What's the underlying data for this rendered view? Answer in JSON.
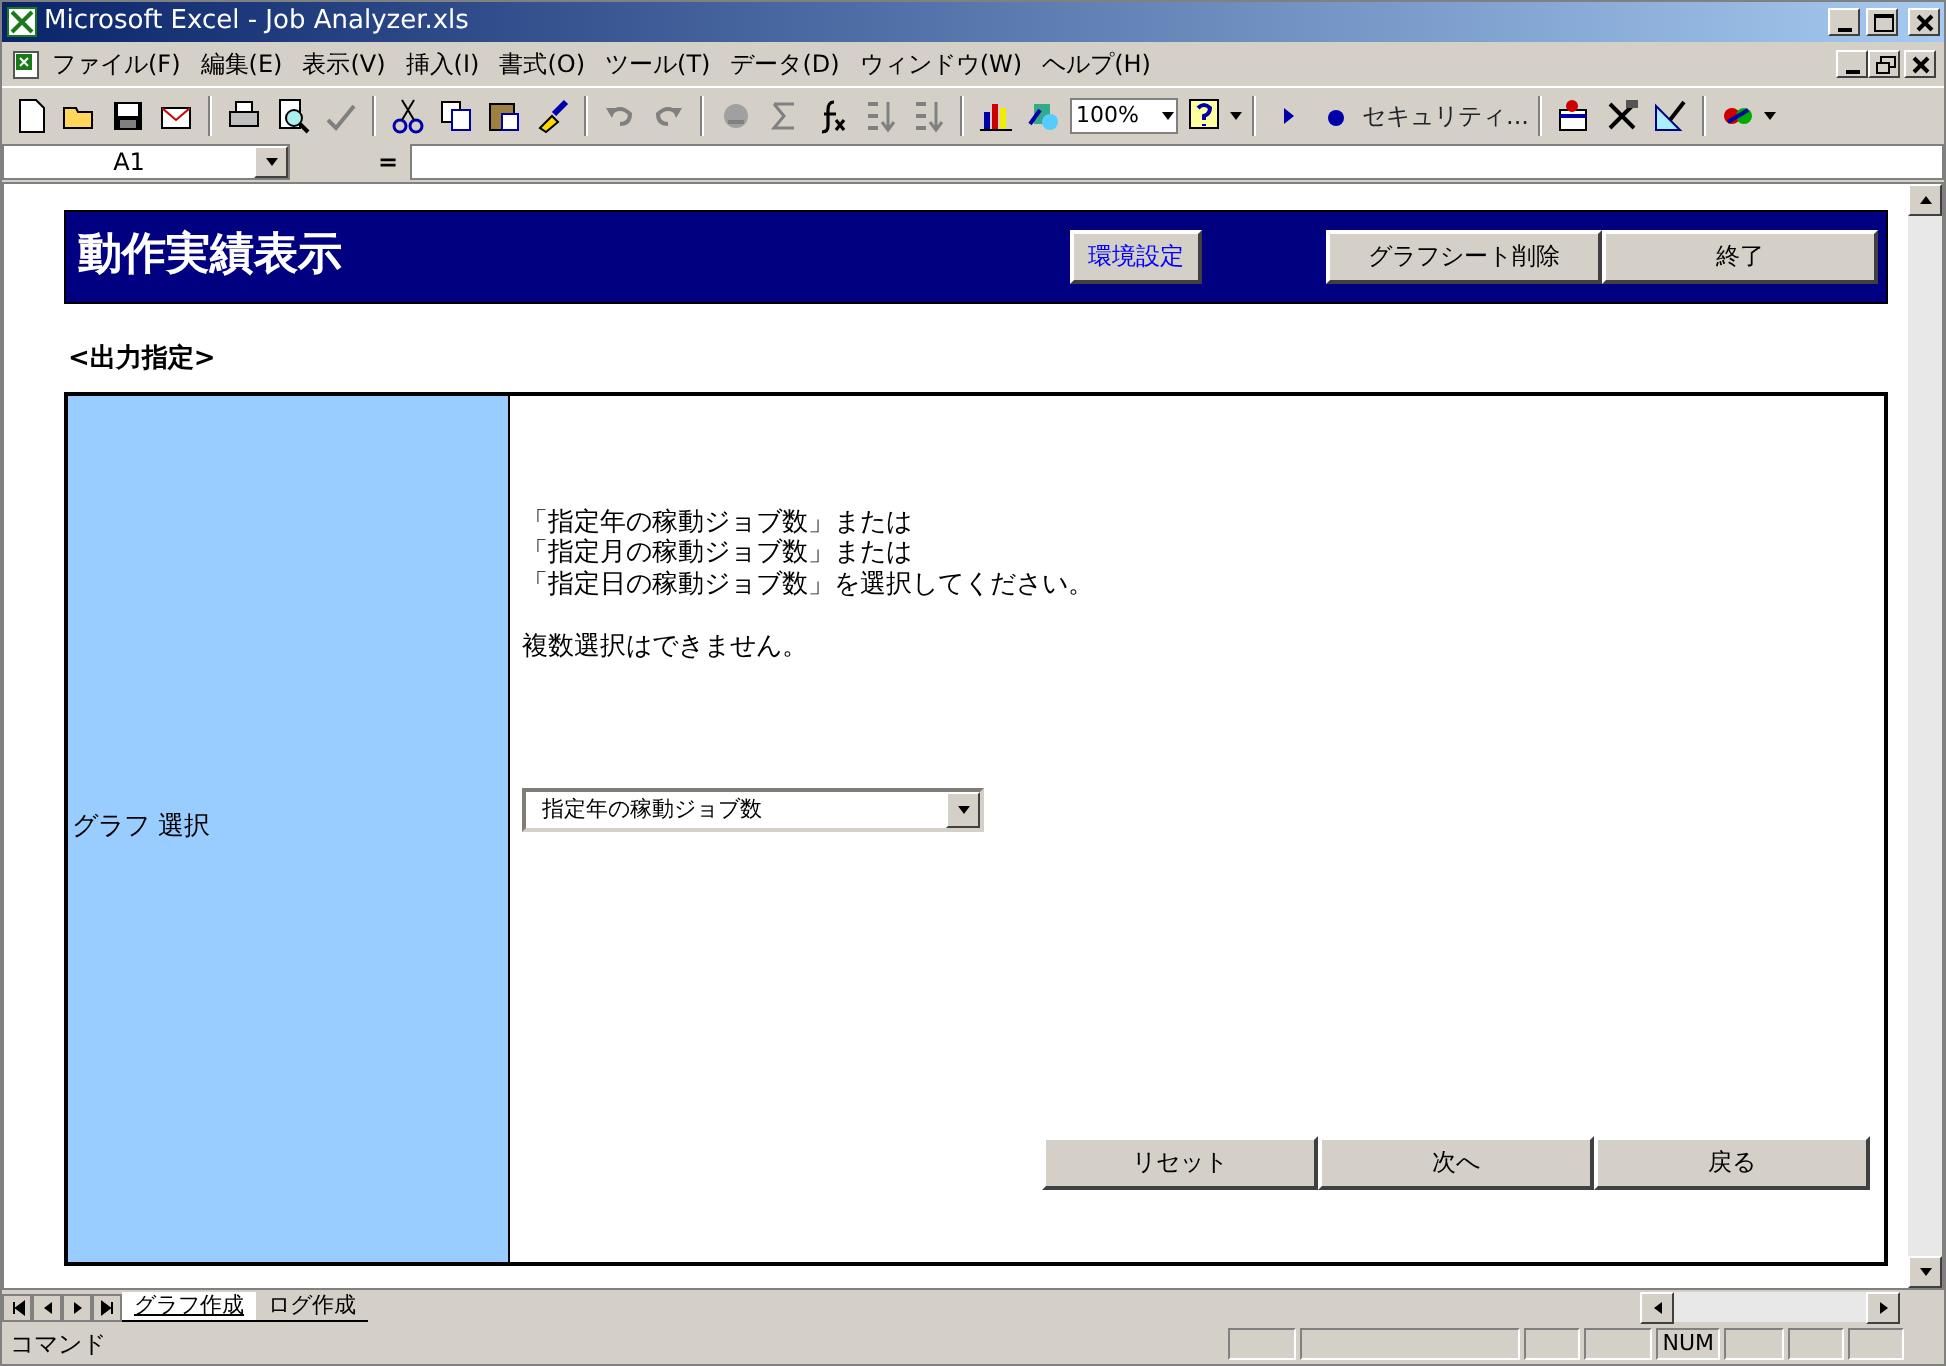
{
  "window": {
    "title": "Microsoft Excel - Job Analyzer.xls"
  },
  "menu_bar": {
    "items": [
      "ファイル(F)",
      "編集(E)",
      "表示(V)",
      "挿入(I)",
      "書式(O)",
      "ツール(T)",
      "データ(D)",
      "ウィンドウ(W)",
      "ヘルプ(H)"
    ]
  },
  "toolbar": {
    "zoom": "100%",
    "security": "セキュリティ..."
  },
  "formula_bar": {
    "name_box": "A1",
    "equals": "="
  },
  "sheet": {
    "header": {
      "title": "動作実績表示",
      "buttons": [
        {
          "label": "環境設定",
          "kind": "link"
        },
        {
          "label": "グラフシート削除",
          "kind": "plain"
        },
        {
          "label": "終了",
          "kind": "plain"
        }
      ]
    },
    "section_label": "<出力指定>",
    "form": {
      "label": "グラフ 選択",
      "instructions": [
        "「指定年の稼動ジョブ数」または",
        "「指定月の稼動ジョブ数」または",
        "「指定日の稼動ジョブ数」を選択してください。"
      ],
      "note": "複数選択はできません。",
      "dropdown": {
        "value": "指定年の稼動ジョブ数"
      },
      "buttons": [
        "リセット",
        "次へ",
        "戻る"
      ]
    }
  },
  "sheet_tabs": [
    {
      "label": "グラフ作成",
      "selected": true
    },
    {
      "label": "ログ作成",
      "selected": false
    }
  ],
  "status_bar": {
    "mode": "コマンド",
    "indicator": "NUM"
  }
}
